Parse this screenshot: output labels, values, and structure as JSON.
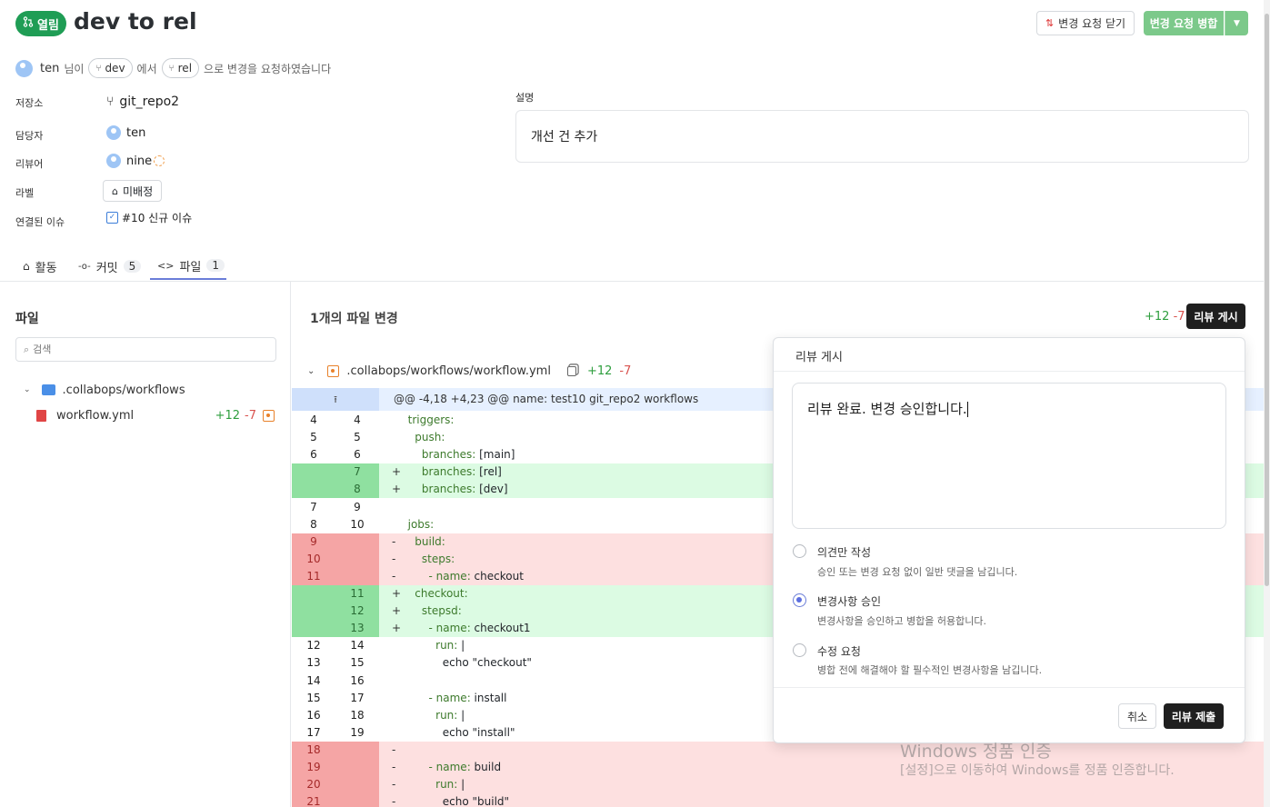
{
  "header": {
    "status_label": "열림",
    "title": "dev to rel",
    "close_button": "변경 요청 닫기",
    "merge_button": "변경 요청 병합",
    "author": "ten",
    "author_suffix": "님이",
    "source_branch": "dev",
    "from_word": "에서",
    "target_branch": "rel",
    "request_text": "으로 변경을 요청하였습니다"
  },
  "meta": {
    "repo_label": "저장소",
    "repo_value": "git_repo2",
    "assignee_label": "담당자",
    "assignee_value": "ten",
    "reviewer_label": "리뷰어",
    "reviewer_value": "nine",
    "label_label": "라벨",
    "label_value": "미배정",
    "issue_label": "연결된 이슈",
    "issue_value": "#10 신규 이슈",
    "description_label": "설명",
    "description_value": "개선 건 추가"
  },
  "tabs": [
    {
      "label": "활동",
      "count": ""
    },
    {
      "label": "커밋",
      "count": "5"
    },
    {
      "label": "파일",
      "count": "1"
    }
  ],
  "sidebar": {
    "title": "파일",
    "search_placeholder": "검색",
    "folder": ".collabops/workflows",
    "file": "workflow.yml",
    "file_added": "+12",
    "file_removed": "-7"
  },
  "main": {
    "changes_title": "1개의 파일 변경",
    "total_added": "+12",
    "total_removed": "-7",
    "post_review_button": "리뷰 게시",
    "file_path": ".collabops/workflows/workflow.yml",
    "file_added": "+12",
    "file_removed": "-7",
    "hunk_header": "@@ -4,18 +4,23 @@ name: test10 git_repo2 workflows",
    "diff_lines": [
      {
        "old": "4",
        "new": "4",
        "type": "ctx",
        "sign": "",
        "text": "  triggers:"
      },
      {
        "old": "5",
        "new": "5",
        "type": "ctx",
        "sign": "",
        "text": "    push:"
      },
      {
        "old": "6",
        "new": "6",
        "type": "ctx",
        "sign": "",
        "text": "      branches: [main]"
      },
      {
        "old": "",
        "new": "7",
        "type": "add",
        "sign": "+",
        "text": "      branches: [rel]"
      },
      {
        "old": "",
        "new": "8",
        "type": "add",
        "sign": "+",
        "text": "      branches: [dev]"
      },
      {
        "old": "7",
        "new": "9",
        "type": "ctx",
        "sign": "",
        "text": ""
      },
      {
        "old": "8",
        "new": "10",
        "type": "ctx",
        "sign": "",
        "text": "  jobs:"
      },
      {
        "old": "9",
        "new": "",
        "type": "del",
        "sign": "-",
        "text": "    build:"
      },
      {
        "old": "10",
        "new": "",
        "type": "del",
        "sign": "-",
        "text": "      steps:"
      },
      {
        "old": "11",
        "new": "",
        "type": "del",
        "sign": "-",
        "text": "        - name: checkout"
      },
      {
        "old": "",
        "new": "11",
        "type": "add",
        "sign": "+",
        "text": "    checkout:"
      },
      {
        "old": "",
        "new": "12",
        "type": "add",
        "sign": "+",
        "text": "      stepsd:"
      },
      {
        "old": "",
        "new": "13",
        "type": "add",
        "sign": "+",
        "text": "        - name: checkout1"
      },
      {
        "old": "12",
        "new": "14",
        "type": "ctx",
        "sign": "",
        "text": "          run: |"
      },
      {
        "old": "13",
        "new": "15",
        "type": "ctx",
        "sign": "",
        "text": "            echo \"checkout\""
      },
      {
        "old": "14",
        "new": "16",
        "type": "ctx",
        "sign": "",
        "text": ""
      },
      {
        "old": "15",
        "new": "17",
        "type": "ctx",
        "sign": "",
        "text": "        - name: install"
      },
      {
        "old": "16",
        "new": "18",
        "type": "ctx",
        "sign": "",
        "text": "          run: |"
      },
      {
        "old": "17",
        "new": "19",
        "type": "ctx",
        "sign": "",
        "text": "            echo \"install\""
      },
      {
        "old": "18",
        "new": "",
        "type": "del",
        "sign": "-",
        "text": ""
      },
      {
        "old": "19",
        "new": "",
        "type": "del",
        "sign": "-",
        "text": "        - name: build"
      },
      {
        "old": "20",
        "new": "",
        "type": "del",
        "sign": "-",
        "text": "          run: |"
      },
      {
        "old": "21",
        "new": "",
        "type": "del",
        "sign": "-",
        "text": "            echo \"build\""
      }
    ]
  },
  "review_popup": {
    "title": "리뷰 게시",
    "comment": "리뷰 완료. 변경 승인합니다.",
    "options": [
      {
        "label": "의견만 작성",
        "desc": "승인 또는 변경 요청 없이 일반 댓글을 남깁니다.",
        "selected": false
      },
      {
        "label": "변경사항 승인",
        "desc": "변경사항을 승인하고 병합을 허용합니다.",
        "selected": true
      },
      {
        "label": "수정 요청",
        "desc": "병합 전에 해결해야 할 필수적인 변경사항을 남깁니다.",
        "selected": false
      }
    ],
    "cancel_button": "취소",
    "submit_button": "리뷰 제출"
  },
  "watermark": {
    "line1": "Windows 정품 인증",
    "line2": "[설정]으로 이동하여 Windows를 정품 인증합니다."
  },
  "colors": {
    "open_green": "#1f9d55",
    "merge_green": "#7cc98a",
    "add_bg": "#dcfbe3",
    "add_ln_bg": "#8fe0a0",
    "del_bg": "#fde0e0",
    "del_ln_bg": "#f5a5a5",
    "hunk_bg": "#e6f0ff"
  }
}
